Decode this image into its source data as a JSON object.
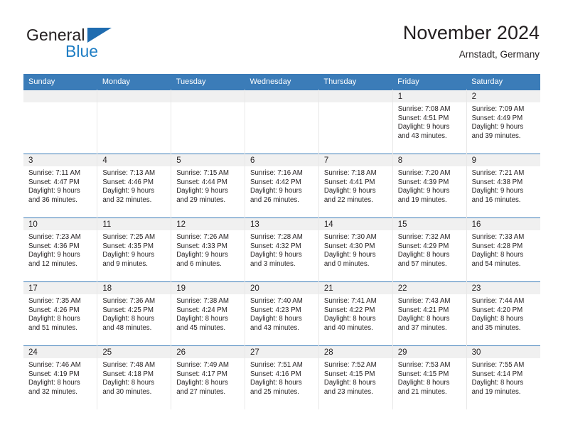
{
  "brand": {
    "name_part1": "General",
    "name_part2": "Blue",
    "triangle_color": "#1f6cb0",
    "blue_color": "#1f7ec4"
  },
  "header": {
    "month_title": "November 2024",
    "location": "Arnstadt, Germany"
  },
  "theme": {
    "header_bg": "#3b7cb8",
    "date_band_bg": "#f0f0f0",
    "text_color": "#231f20",
    "cell_border": "#e8e8e8"
  },
  "weekdays": [
    "Sunday",
    "Monday",
    "Tuesday",
    "Wednesday",
    "Thursday",
    "Friday",
    "Saturday"
  ],
  "weeks": [
    [
      {
        "day": "",
        "empty": true
      },
      {
        "day": "",
        "empty": true
      },
      {
        "day": "",
        "empty": true
      },
      {
        "day": "",
        "empty": true
      },
      {
        "day": "",
        "empty": true
      },
      {
        "day": "1",
        "sunrise": "Sunrise: 7:08 AM",
        "sunset": "Sunset: 4:51 PM",
        "daylight_line1": "Daylight: 9 hours",
        "daylight_line2": "and 43 minutes."
      },
      {
        "day": "2",
        "sunrise": "Sunrise: 7:09 AM",
        "sunset": "Sunset: 4:49 PM",
        "daylight_line1": "Daylight: 9 hours",
        "daylight_line2": "and 39 minutes."
      }
    ],
    [
      {
        "day": "3",
        "sunrise": "Sunrise: 7:11 AM",
        "sunset": "Sunset: 4:47 PM",
        "daylight_line1": "Daylight: 9 hours",
        "daylight_line2": "and 36 minutes."
      },
      {
        "day": "4",
        "sunrise": "Sunrise: 7:13 AM",
        "sunset": "Sunset: 4:46 PM",
        "daylight_line1": "Daylight: 9 hours",
        "daylight_line2": "and 32 minutes."
      },
      {
        "day": "5",
        "sunrise": "Sunrise: 7:15 AM",
        "sunset": "Sunset: 4:44 PM",
        "daylight_line1": "Daylight: 9 hours",
        "daylight_line2": "and 29 minutes."
      },
      {
        "day": "6",
        "sunrise": "Sunrise: 7:16 AM",
        "sunset": "Sunset: 4:42 PM",
        "daylight_line1": "Daylight: 9 hours",
        "daylight_line2": "and 26 minutes."
      },
      {
        "day": "7",
        "sunrise": "Sunrise: 7:18 AM",
        "sunset": "Sunset: 4:41 PM",
        "daylight_line1": "Daylight: 9 hours",
        "daylight_line2": "and 22 minutes."
      },
      {
        "day": "8",
        "sunrise": "Sunrise: 7:20 AM",
        "sunset": "Sunset: 4:39 PM",
        "daylight_line1": "Daylight: 9 hours",
        "daylight_line2": "and 19 minutes."
      },
      {
        "day": "9",
        "sunrise": "Sunrise: 7:21 AM",
        "sunset": "Sunset: 4:38 PM",
        "daylight_line1": "Daylight: 9 hours",
        "daylight_line2": "and 16 minutes."
      }
    ],
    [
      {
        "day": "10",
        "sunrise": "Sunrise: 7:23 AM",
        "sunset": "Sunset: 4:36 PM",
        "daylight_line1": "Daylight: 9 hours",
        "daylight_line2": "and 12 minutes."
      },
      {
        "day": "11",
        "sunrise": "Sunrise: 7:25 AM",
        "sunset": "Sunset: 4:35 PM",
        "daylight_line1": "Daylight: 9 hours",
        "daylight_line2": "and 9 minutes."
      },
      {
        "day": "12",
        "sunrise": "Sunrise: 7:26 AM",
        "sunset": "Sunset: 4:33 PM",
        "daylight_line1": "Daylight: 9 hours",
        "daylight_line2": "and 6 minutes."
      },
      {
        "day": "13",
        "sunrise": "Sunrise: 7:28 AM",
        "sunset": "Sunset: 4:32 PM",
        "daylight_line1": "Daylight: 9 hours",
        "daylight_line2": "and 3 minutes."
      },
      {
        "day": "14",
        "sunrise": "Sunrise: 7:30 AM",
        "sunset": "Sunset: 4:30 PM",
        "daylight_line1": "Daylight: 9 hours",
        "daylight_line2": "and 0 minutes."
      },
      {
        "day": "15",
        "sunrise": "Sunrise: 7:32 AM",
        "sunset": "Sunset: 4:29 PM",
        "daylight_line1": "Daylight: 8 hours",
        "daylight_line2": "and 57 minutes."
      },
      {
        "day": "16",
        "sunrise": "Sunrise: 7:33 AM",
        "sunset": "Sunset: 4:28 PM",
        "daylight_line1": "Daylight: 8 hours",
        "daylight_line2": "and 54 minutes."
      }
    ],
    [
      {
        "day": "17",
        "sunrise": "Sunrise: 7:35 AM",
        "sunset": "Sunset: 4:26 PM",
        "daylight_line1": "Daylight: 8 hours",
        "daylight_line2": "and 51 minutes."
      },
      {
        "day": "18",
        "sunrise": "Sunrise: 7:36 AM",
        "sunset": "Sunset: 4:25 PM",
        "daylight_line1": "Daylight: 8 hours",
        "daylight_line2": "and 48 minutes."
      },
      {
        "day": "19",
        "sunrise": "Sunrise: 7:38 AM",
        "sunset": "Sunset: 4:24 PM",
        "daylight_line1": "Daylight: 8 hours",
        "daylight_line2": "and 45 minutes."
      },
      {
        "day": "20",
        "sunrise": "Sunrise: 7:40 AM",
        "sunset": "Sunset: 4:23 PM",
        "daylight_line1": "Daylight: 8 hours",
        "daylight_line2": "and 43 minutes."
      },
      {
        "day": "21",
        "sunrise": "Sunrise: 7:41 AM",
        "sunset": "Sunset: 4:22 PM",
        "daylight_line1": "Daylight: 8 hours",
        "daylight_line2": "and 40 minutes."
      },
      {
        "day": "22",
        "sunrise": "Sunrise: 7:43 AM",
        "sunset": "Sunset: 4:21 PM",
        "daylight_line1": "Daylight: 8 hours",
        "daylight_line2": "and 37 minutes."
      },
      {
        "day": "23",
        "sunrise": "Sunrise: 7:44 AM",
        "sunset": "Sunset: 4:20 PM",
        "daylight_line1": "Daylight: 8 hours",
        "daylight_line2": "and 35 minutes."
      }
    ],
    [
      {
        "day": "24",
        "sunrise": "Sunrise: 7:46 AM",
        "sunset": "Sunset: 4:19 PM",
        "daylight_line1": "Daylight: 8 hours",
        "daylight_line2": "and 32 minutes."
      },
      {
        "day": "25",
        "sunrise": "Sunrise: 7:48 AM",
        "sunset": "Sunset: 4:18 PM",
        "daylight_line1": "Daylight: 8 hours",
        "daylight_line2": "and 30 minutes."
      },
      {
        "day": "26",
        "sunrise": "Sunrise: 7:49 AM",
        "sunset": "Sunset: 4:17 PM",
        "daylight_line1": "Daylight: 8 hours",
        "daylight_line2": "and 27 minutes."
      },
      {
        "day": "27",
        "sunrise": "Sunrise: 7:51 AM",
        "sunset": "Sunset: 4:16 PM",
        "daylight_line1": "Daylight: 8 hours",
        "daylight_line2": "and 25 minutes."
      },
      {
        "day": "28",
        "sunrise": "Sunrise: 7:52 AM",
        "sunset": "Sunset: 4:15 PM",
        "daylight_line1": "Daylight: 8 hours",
        "daylight_line2": "and 23 minutes."
      },
      {
        "day": "29",
        "sunrise": "Sunrise: 7:53 AM",
        "sunset": "Sunset: 4:15 PM",
        "daylight_line1": "Daylight: 8 hours",
        "daylight_line2": "and 21 minutes."
      },
      {
        "day": "30",
        "sunrise": "Sunrise: 7:55 AM",
        "sunset": "Sunset: 4:14 PM",
        "daylight_line1": "Daylight: 8 hours",
        "daylight_line2": "and 19 minutes."
      }
    ]
  ]
}
